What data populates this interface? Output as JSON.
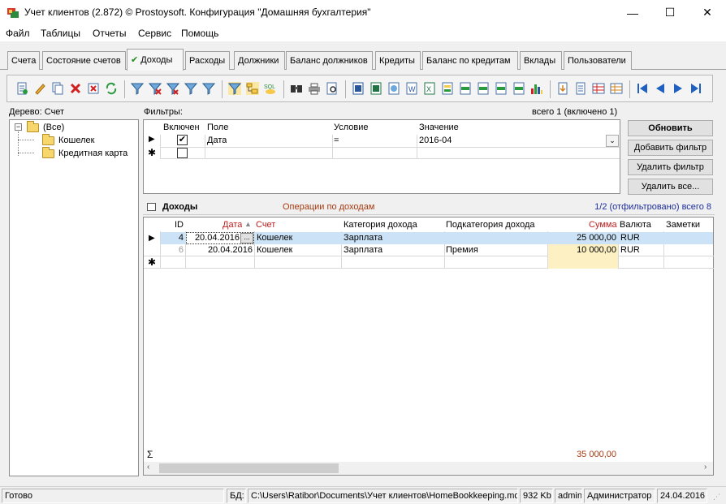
{
  "window": {
    "title": "Учет клиентов (2.872) © Prostoysoft. Конфигурация \"Домашняя бухгалтерия\"",
    "minimize": "—",
    "maximize": "☐",
    "close": "✕"
  },
  "menu": [
    "Файл",
    "Таблицы",
    "Отчеты",
    "Сервис",
    "Помощь"
  ],
  "tabs": [
    "Счета",
    "Состояние счетов",
    "Доходы",
    "Расходы",
    "Должники",
    "Баланс должников",
    "Кредиты",
    "Баланс по кредитам",
    "Вклады",
    "Пользователи"
  ],
  "active_tab": "Доходы",
  "toolbar_icons": [
    "new-record-icon",
    "edit-icon",
    "copy-icon",
    "delete-icon",
    "delete-all-icon",
    "refresh-icon",
    "filter-icon",
    "filter-clear-icon",
    "filter-remove-icon",
    "filter-edit-icon",
    "filter-options-icon",
    "filter-active-icon",
    "tree-icon",
    "sql-icon",
    "find-icon",
    "print-icon",
    "print-preview-icon",
    "export-word-icon",
    "export-excel-icon",
    "export-html-icon",
    "export-rtf-icon",
    "export-xls-icon",
    "export-csv-icon",
    "export-xml-icon",
    "export-txt-icon",
    "export-mail-icon",
    "chart-icon",
    "import-icon",
    "import-file-icon",
    "report-icon",
    "report-edit-icon",
    "first-record-icon",
    "prev-record-icon",
    "next-record-icon",
    "last-record-icon"
  ],
  "tree": {
    "label": "Дерево: Счет",
    "root": "(Все)",
    "items": [
      "Кошелек",
      "Кредитная карта"
    ]
  },
  "filters": {
    "label": "Фильтры:",
    "summary": "всего 1 (включено 1)",
    "columns": [
      "Включен",
      "Поле",
      "Условие",
      "Значение"
    ],
    "row": {
      "enabled": true,
      "field": "Дата",
      "condition": "=",
      "value": "2016-04"
    }
  },
  "filter_buttons": [
    "Обновить",
    "Добавить фильтр",
    "Удалить фильтр",
    "Удалить все..."
  ],
  "income": {
    "title": "Доходы",
    "subtitle": "Операции по доходам",
    "count": "1/2 (отфильтровано) всего 8",
    "columns": [
      "ID",
      "Дата",
      "Счет",
      "Категория дохода",
      "Подкатегория дохода",
      "Сумма",
      "Валюта",
      "Заметки"
    ],
    "sort_mark": "▲",
    "rows": [
      {
        "id": "4",
        "date": "20.04.2016",
        "account": "Кошелек",
        "category": "Зарплата",
        "subcategory": "",
        "amount": "25 000,00",
        "currency": "RUR",
        "note": ""
      },
      {
        "id": "6",
        "date": "20.04.2016",
        "account": "Кошелек",
        "category": "Зарплата",
        "subcategory": "Премия",
        "amount": "10 000,00",
        "currency": "RUR",
        "note": ""
      }
    ],
    "total_symbol": "Σ",
    "total": "35 000,00"
  },
  "status": {
    "ready": "Готово",
    "db_label": "БД:",
    "db_path": "C:\\Users\\Ratibor\\Documents\\Учет клиентов\\HomeBookkeeping.mdb",
    "size": "932 Kb",
    "user": "admin",
    "role": "Администратор",
    "date": "24.04.2016"
  },
  "colors": {
    "selection": "#cce3f7",
    "accent_red": "#c02020",
    "accent_blue": "#1e2e9e",
    "amount_bg": "#fdf1c3"
  }
}
